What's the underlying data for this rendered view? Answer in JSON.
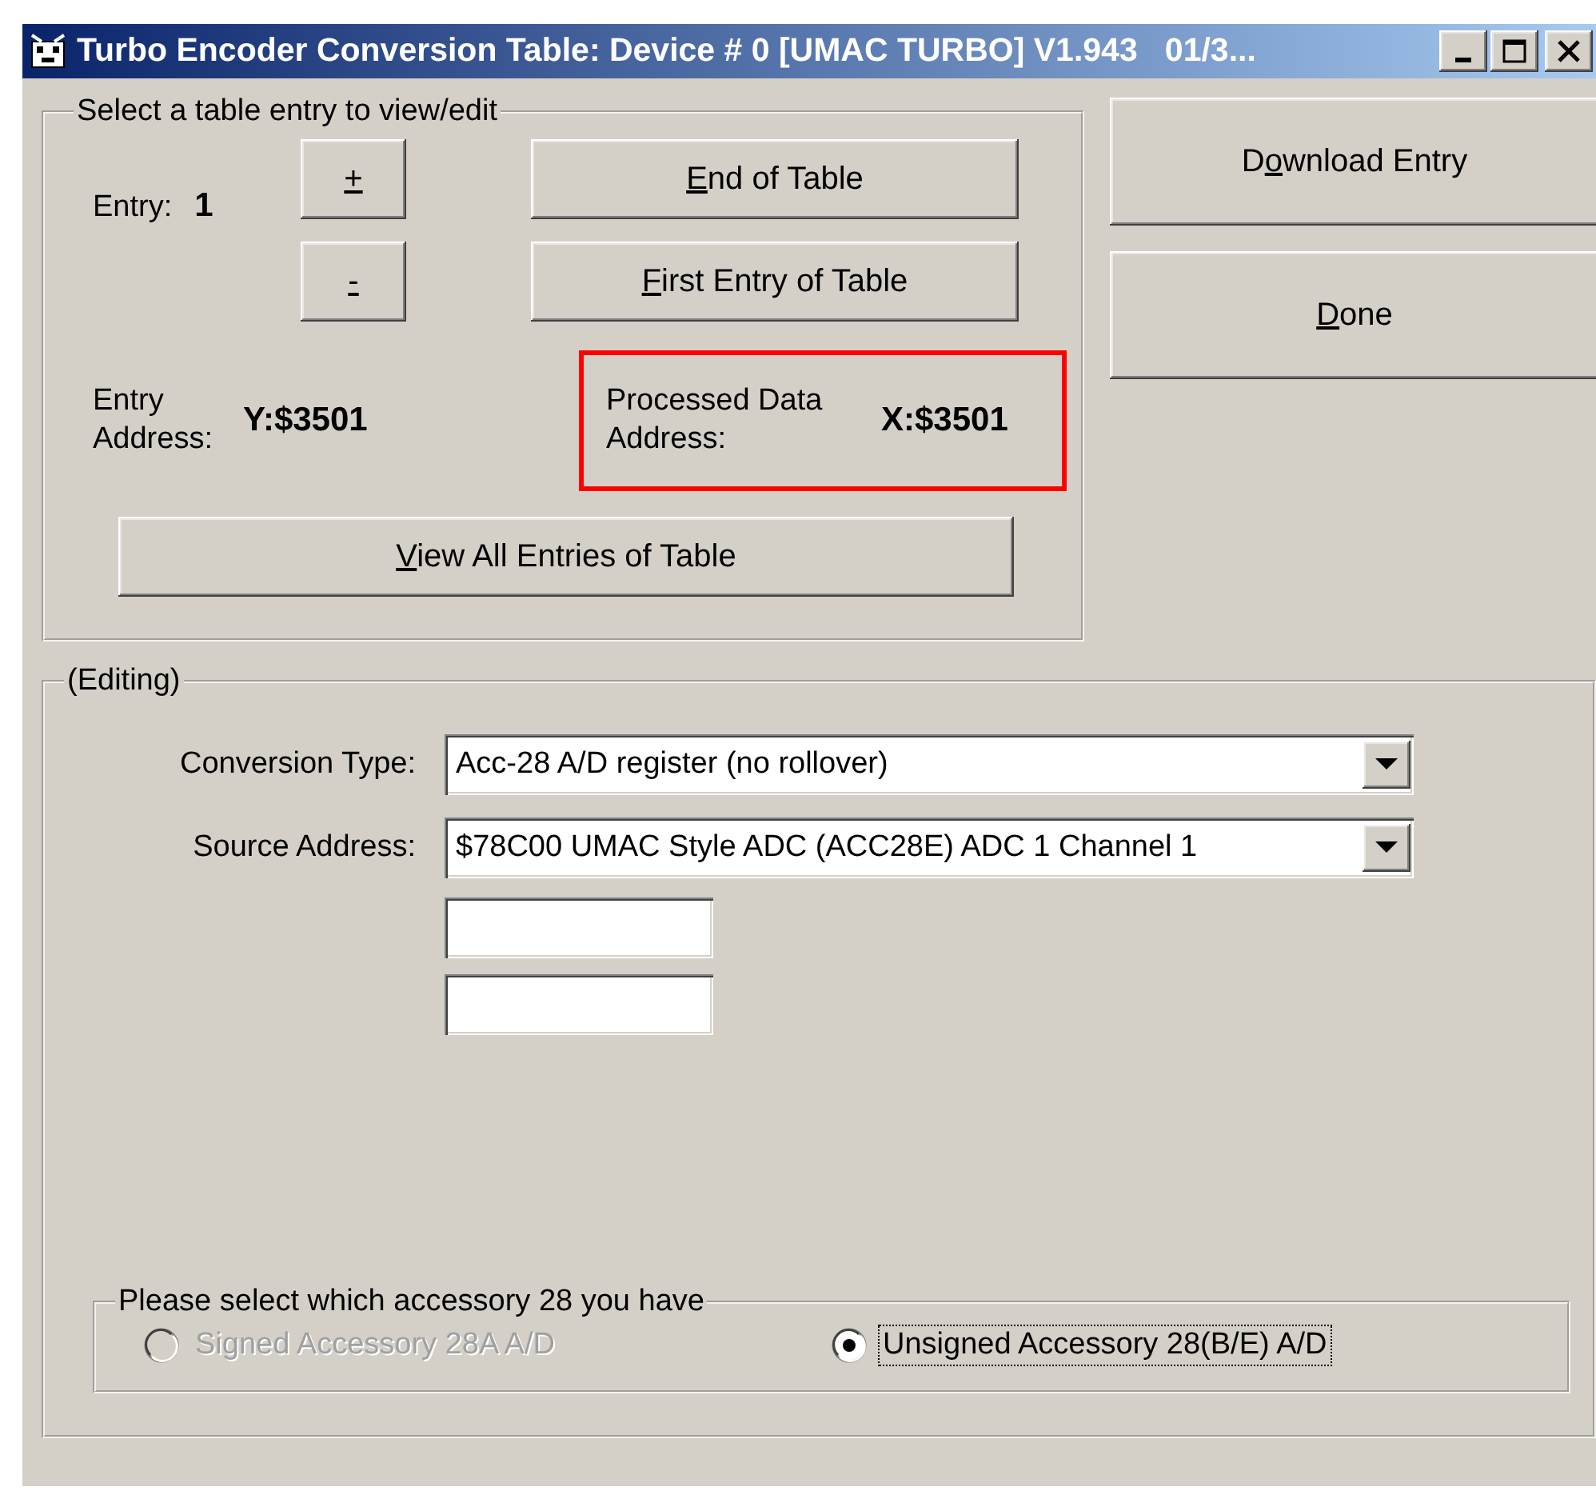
{
  "window": {
    "title": "Turbo Encoder Conversion Table: Device # 0 [UMAC TURBO] V1.943   01/3..."
  },
  "entry_selector": {
    "legend": "Select a table entry to view/edit",
    "entry_label": "Entry:",
    "entry_value": "1",
    "increment_button": {
      "key": "+"
    },
    "decrement_button": {
      "key": "-"
    },
    "end_button": {
      "key": "E",
      "after": "nd of Table"
    },
    "first_button": {
      "key": "F",
      "after": "irst Entry of Table"
    },
    "entry_address_label": "Entry Address:",
    "entry_address_value": "Y:$3501",
    "processed_address": {
      "label": "Processed Data Address:",
      "value": "X:$3501",
      "highlighted": true
    },
    "view_all_button": {
      "key": "V",
      "after": "iew All Entries of Table"
    }
  },
  "side_buttons": [
    {
      "before": "D",
      "key": "o",
      "after": "wnload Entry"
    },
    {
      "key": "D",
      "after": "one"
    }
  ],
  "editing": {
    "legend": "(Editing)",
    "conversion_type": {
      "label": "Conversion Type:",
      "value": "Acc-28 A/D register (no rollover)"
    },
    "source_address": {
      "label": "Source Address:",
      "value": "$78C00 UMAC Style ADC (ACC28E) ADC 1 Channel 1"
    },
    "accessory": {
      "legend": "Please select which accessory 28 you have",
      "options": [
        {
          "label": "Signed Accessory 28A A/D",
          "selected": false,
          "disabled": true,
          "focused": false
        },
        {
          "label": "Unsigned Accessory 28(B/E) A/D",
          "selected": true,
          "disabled": false,
          "focused": true
        }
      ]
    }
  }
}
